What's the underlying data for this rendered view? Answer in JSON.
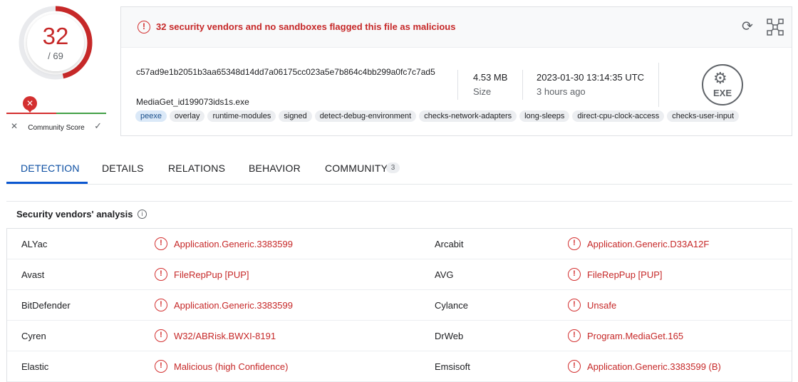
{
  "score": {
    "detections": "32",
    "total": "/ 69",
    "fraction": 0.464,
    "color": "#c62828"
  },
  "community": {
    "label": "Community Score",
    "marker_icon": "close-icon",
    "down_icon": "close-icon",
    "up_icon": "check-icon"
  },
  "summary": {
    "alert_text": "32 security vendors and no sandboxes flagged this file as malicious",
    "hash": "c57ad9e1b2051b3aa65348d14dd7a06175cc023a5e7b864c4bb299a0fc7c7ad5",
    "filename": "MediaGet_id199073ids1s.exe",
    "size_value": "4.53 MB",
    "size_label": "Size",
    "date_value": "2023-01-30 13:14:35 UTC",
    "date_label": "3 hours ago",
    "file_type": "EXE",
    "tags": [
      "peexe",
      "overlay",
      "runtime-modules",
      "signed",
      "detect-debug-environment",
      "checks-network-adapters",
      "long-sleeps",
      "direct-cpu-clock-access",
      "checks-user-input"
    ]
  },
  "tabs": [
    {
      "label": "DETECTION",
      "active": true
    },
    {
      "label": "DETAILS"
    },
    {
      "label": "RELATIONS"
    },
    {
      "label": "BEHAVIOR"
    },
    {
      "label": "COMMUNITY",
      "badge": "3"
    }
  ],
  "analysis": {
    "title": "Security vendors' analysis",
    "rows": [
      {
        "left_vendor": "ALYac",
        "left_result": "Application.Generic.3383599",
        "right_vendor": "Arcabit",
        "right_result": "Application.Generic.D33A12F"
      },
      {
        "left_vendor": "Avast",
        "left_result": "FileRepPup [PUP]",
        "right_vendor": "AVG",
        "right_result": "FileRepPup [PUP]"
      },
      {
        "left_vendor": "BitDefender",
        "left_result": "Application.Generic.3383599",
        "right_vendor": "Cylance",
        "right_result": "Unsafe"
      },
      {
        "left_vendor": "Cyren",
        "left_result": "W32/ABRisk.BWXI-8191",
        "right_vendor": "DrWeb",
        "right_result": "Program.MediaGet.165"
      },
      {
        "left_vendor": "Elastic",
        "left_result": "Malicious (high Confidence)",
        "right_vendor": "Emsisoft",
        "right_result": "Application.Generic.3383599 (B)"
      }
    ]
  },
  "colors": {
    "malicious": "#c62828",
    "accent": "#0b57d0",
    "community_bad": "#d32f2f",
    "community_good": "#43a047"
  }
}
